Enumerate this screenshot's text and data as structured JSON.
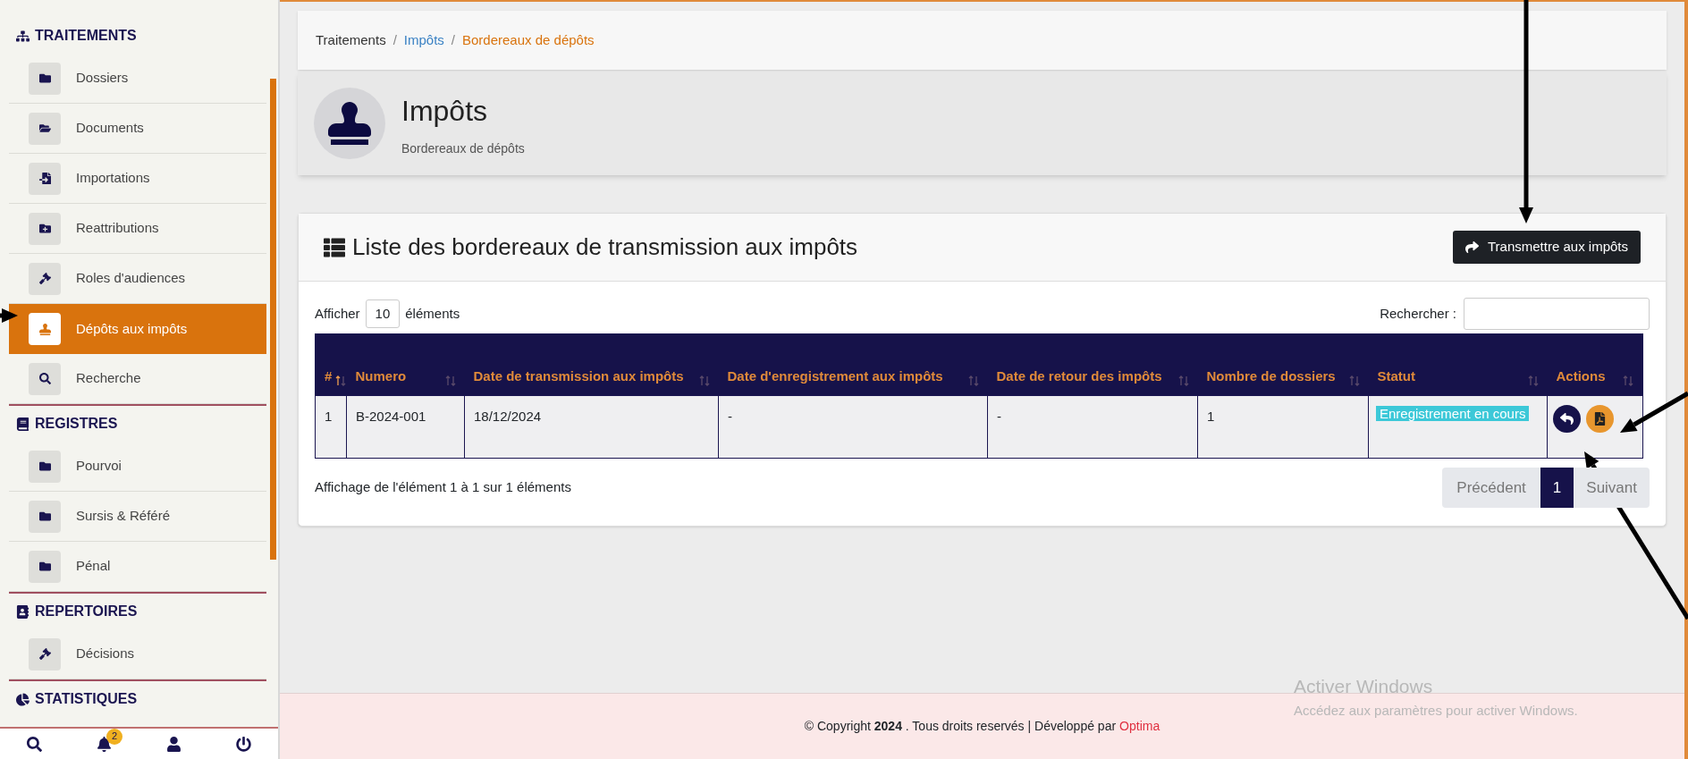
{
  "sidebar": {
    "sections": [
      {
        "title": "TRAITEMENTS",
        "items": [
          {
            "label": "Dossiers",
            "selected": false
          },
          {
            "label": "Documents",
            "selected": false
          },
          {
            "label": "Importations",
            "selected": false
          },
          {
            "label": "Reattributions",
            "selected": false
          },
          {
            "label": "Roles d'audiences",
            "selected": false
          },
          {
            "label": "Dépôts aux impôts",
            "selected": true
          },
          {
            "label": "Recherche",
            "selected": false
          }
        ]
      },
      {
        "title": "REGISTRES",
        "items": [
          {
            "label": "Pourvoi",
            "selected": false
          },
          {
            "label": "Sursis & Référé",
            "selected": false
          },
          {
            "label": "Pénal",
            "selected": false
          }
        ]
      },
      {
        "title": "REPERTOIRES",
        "items": [
          {
            "label": "Décisions",
            "selected": false
          }
        ]
      },
      {
        "title": "STATISTIQUES"
      }
    ],
    "notification_count": "2"
  },
  "breadcrumb": [
    {
      "label": "Traitements",
      "kind": "plain"
    },
    {
      "separator": "/",
      "label": "Impôts",
      "kind": "link"
    },
    {
      "separator": "/",
      "label": "Bordereaux de dépôts",
      "kind": "current"
    }
  ],
  "page_header": {
    "title": "Impôts",
    "subtitle": "Bordereaux de dépôts"
  },
  "card": {
    "title": "Liste des bordereaux de transmission aux impôts",
    "action_button": "Transmettre aux impôts",
    "length_label_before": "Afficher",
    "length_value": "10",
    "length_label_after": "éléments",
    "search_label": "Rechercher :",
    "table": {
      "columns": [
        {
          "label": "#",
          "sorted": true
        },
        {
          "label": "Numero",
          "sorted": false
        },
        {
          "label": "Date de transmission aux impôts",
          "sorted": false
        },
        {
          "label": "Date d'enregistrement aux impôts",
          "sorted": false
        },
        {
          "label": "Date de retour des impôts",
          "sorted": false
        },
        {
          "label": "Nombre de dossiers",
          "sorted": false
        },
        {
          "label": "Statut",
          "sorted": false
        },
        {
          "label": "Actions",
          "sorted": false
        }
      ],
      "rows": [
        {
          "cells": [
            "1",
            "B-2024-001",
            "18/12/2024",
            "-",
            "-",
            "1"
          ],
          "status": "Enregistrement en cours"
        }
      ]
    },
    "info": "Affichage de l'élément 1 à 1 sur 1 éléments",
    "pagination": {
      "previous": "Précédent",
      "next": "Suivant",
      "pages": [
        {
          "label": "1",
          "selected": true
        }
      ]
    }
  },
  "footer": {
    "text": "© Copyright **2024** . Tous droits reservés | Développé par",
    "link": "Optima"
  },
  "os_notice": {
    "title": "Activer Windows",
    "text": "Accédez aux paramètres pour activer Windows."
  }
}
